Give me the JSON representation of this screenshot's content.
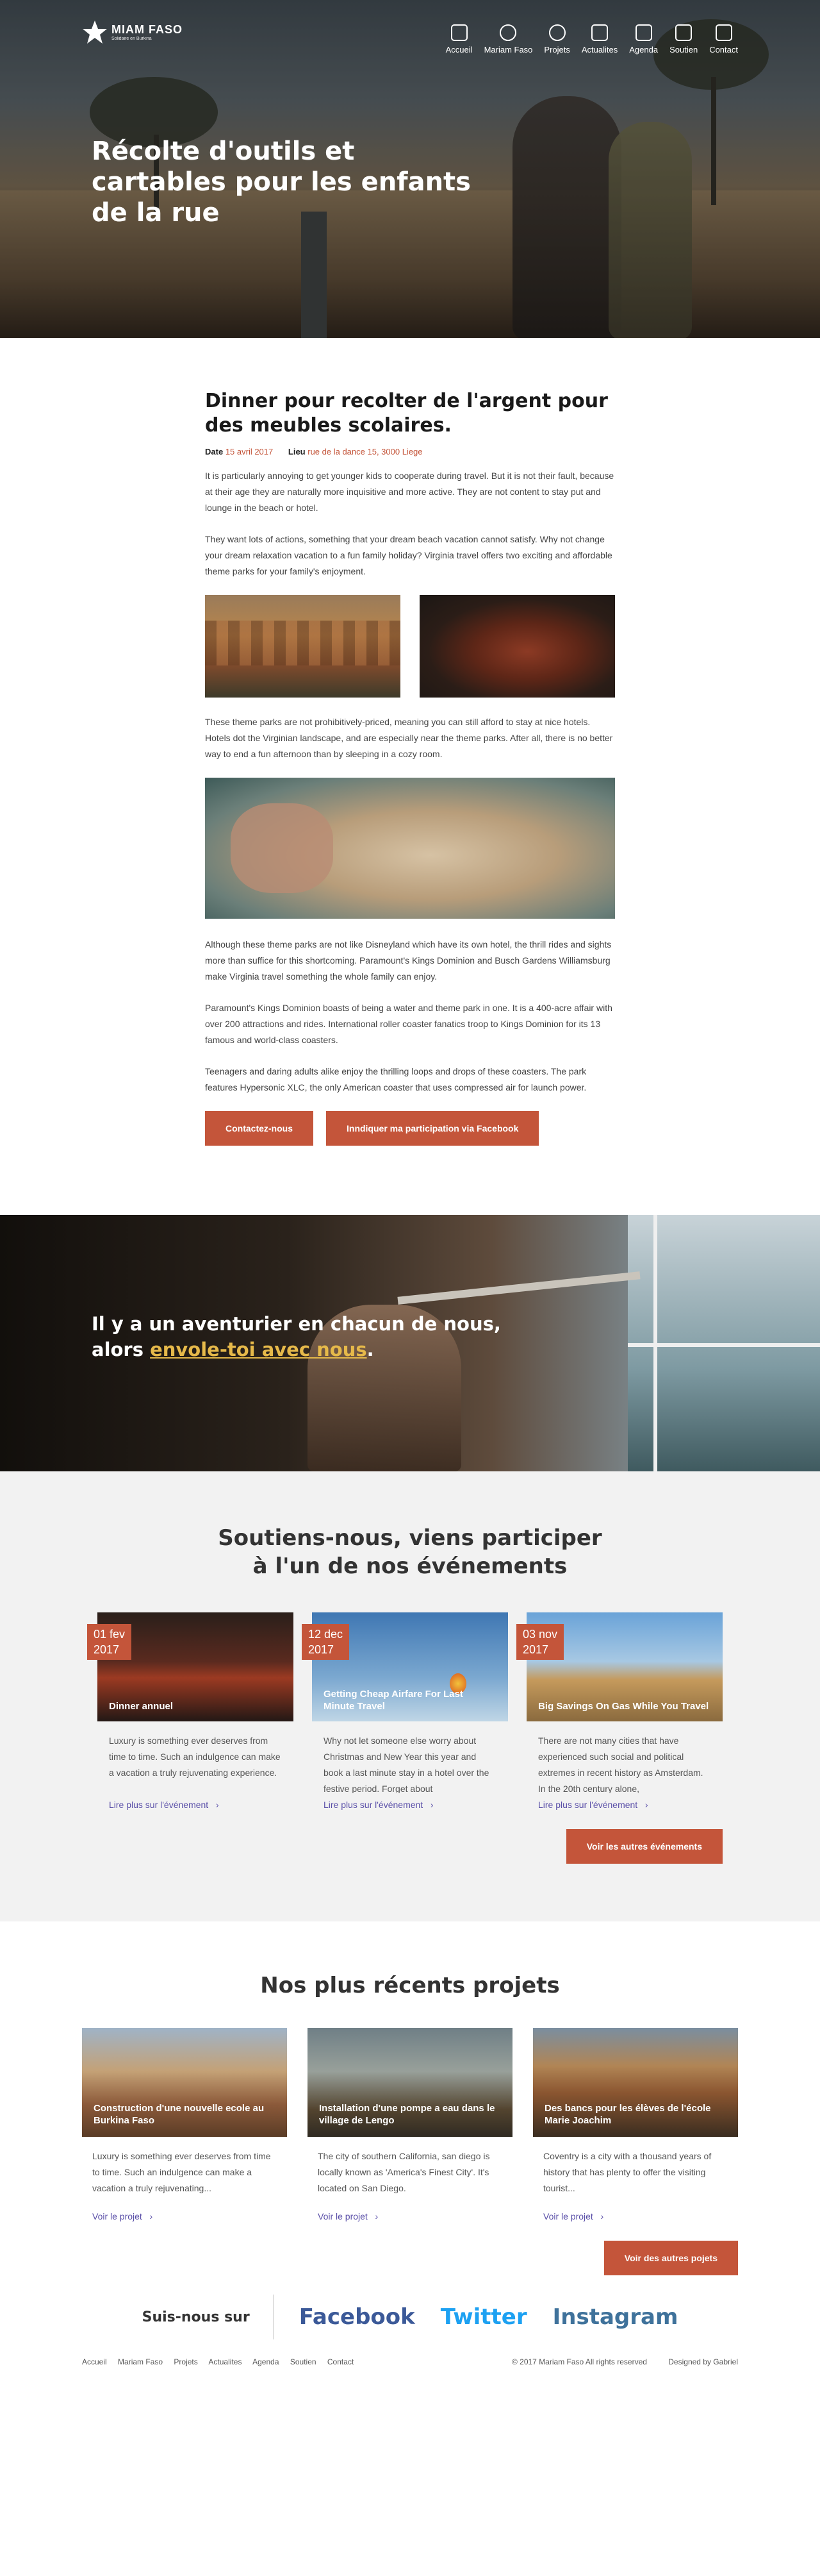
{
  "logo": {
    "name": "MIAM FASO",
    "tagline": "Solidaire en Burkina"
  },
  "nav": [
    {
      "label": "Accueil",
      "icon": "home-icon"
    },
    {
      "label": "Mariam Faso",
      "icon": "smile-icon"
    },
    {
      "label": "Projets",
      "icon": "pencil-icon"
    },
    {
      "label": "Actualites",
      "icon": "document-icon"
    },
    {
      "label": "Agenda",
      "icon": "calendar-icon"
    },
    {
      "label": "Soutien",
      "icon": "gift-icon"
    },
    {
      "label": "Contact",
      "icon": "mail-icon"
    }
  ],
  "hero": {
    "title": "Récolte d'outils et cartables pour les enfants de la rue"
  },
  "article": {
    "title": "Dinner pour recolter de l'argent pour des meubles scolaires.",
    "date_label": "Date",
    "date_value": "15 avril 2017",
    "place_label": "Lieu",
    "place_value": "rue de la dance 15, 3000 Liege",
    "p1": "It is particularly annoying to get younger kids to cooperate during travel. But it is not their fault, because at their age they are naturally more inquisitive and more active. They are not content to stay put and lounge in the beach or hotel.",
    "p2": "They want lots of actions, something that your dream beach vacation cannot satisfy. Why not change your dream relaxation vacation to a fun family holiday? Virginia travel offers two exciting and affordable theme parks for your family's enjoyment.",
    "p3": "These theme parks are not prohibitively-priced, meaning you can still afford to stay at nice hotels. Hotels dot the Virginian landscape, and are especially near the theme parks. After all, there is no better way to end a fun afternoon than by sleeping in a cozy room.",
    "p4": "Although these theme parks are not like Disneyland which have its own hotel, the thrill rides and sights more than suffice for this shortcoming. Paramount's Kings Dominion and Busch Gardens Williamsburg make Virginia travel something the whole family can enjoy.",
    "p5": "Paramount's Kings Dominion boasts of being a water and theme park in one. It is a 400-acre affair with over 200 attractions and rides. International roller coaster fanatics troop to Kings Dominion for its 13 famous and world-class coasters.",
    "p6": "Teenagers and daring adults alike enjoy the thrilling loops and drops of these coasters. The park features Hypersonic XLC, the only American coaster that uses compressed air for launch power.",
    "btn_contact": "Contactez-nous",
    "btn_facebook": "Inndiquer ma participation via Facebook"
  },
  "quote": {
    "line1": "Il y a un aventurier en chacun de nous,",
    "line2_prefix": "alors ",
    "line2_link": "envole-toi avec nous",
    "line2_suffix": "."
  },
  "events": {
    "title_line1": "Soutiens-nous, viens participer",
    "title_line2": "à l'un de nos événements",
    "more_label": "Lire plus sur l'événement",
    "button": "Voir les autres événements",
    "items": [
      {
        "day": "01 fev",
        "year": "2017",
        "title": "Dinner annuel",
        "desc": "Luxury is something ever  deserves from time to time. Such an indulgence can make a vacation a truly rejuvenating experience."
      },
      {
        "day": "12 dec",
        "year": "2017",
        "title": "Getting Cheap Airfare For Last Minute Travel",
        "desc": "Why not let someone else worry about Christmas and New Year this year and book a last minute stay in a hotel over the festive period. Forget about"
      },
      {
        "day": "03 nov",
        "year": "2017",
        "title": "Big Savings On Gas While You Travel",
        "desc": "There are not many cities that have experienced such social and political extremes in recent history as Amsterdam. In the 20th century alone,"
      }
    ]
  },
  "projects": {
    "title": "Nos plus récents projets",
    "more_label": "Voir le projet",
    "button": "Voir des autres pojets",
    "items": [
      {
        "title": "Construction d'une nouvelle ecole au Burkina Faso",
        "desc": "Luxury is something ever  deserves from time to time. Such an indulgence can make a vacation a truly rejuvenating..."
      },
      {
        "title": "Installation d'une pompe a eau dans  le village de Lengo",
        "desc": "The city of southern California, san diego is locally known as 'America's Finest City'. It's located on San Diego."
      },
      {
        "title": "Des bancs pour les élèves de l'école Marie Joachim",
        "desc": "Coventry is a city with a thousand years of history that has plenty to offer the visiting tourist..."
      }
    ]
  },
  "social": {
    "label": "Suis-nous sur",
    "facebook": "Facebook",
    "twitter": "Twitter",
    "instagram": "Instagram",
    "colors": {
      "facebook": "#3b5998",
      "twitter": "#1da1f2",
      "instagram": "#3f729b"
    }
  },
  "footer": {
    "links": [
      "Accueil",
      "Mariam Faso",
      "Projets",
      "Actualites",
      "Agenda",
      "Soutien",
      "Contact"
    ],
    "copyright": "© 2017 Mariam Faso All rights reserved",
    "designed": "Designed by Gabriel"
  },
  "colors": {
    "accent": "#c4553a",
    "link": "#5a4fa8",
    "highlight": "#e6b94a"
  }
}
